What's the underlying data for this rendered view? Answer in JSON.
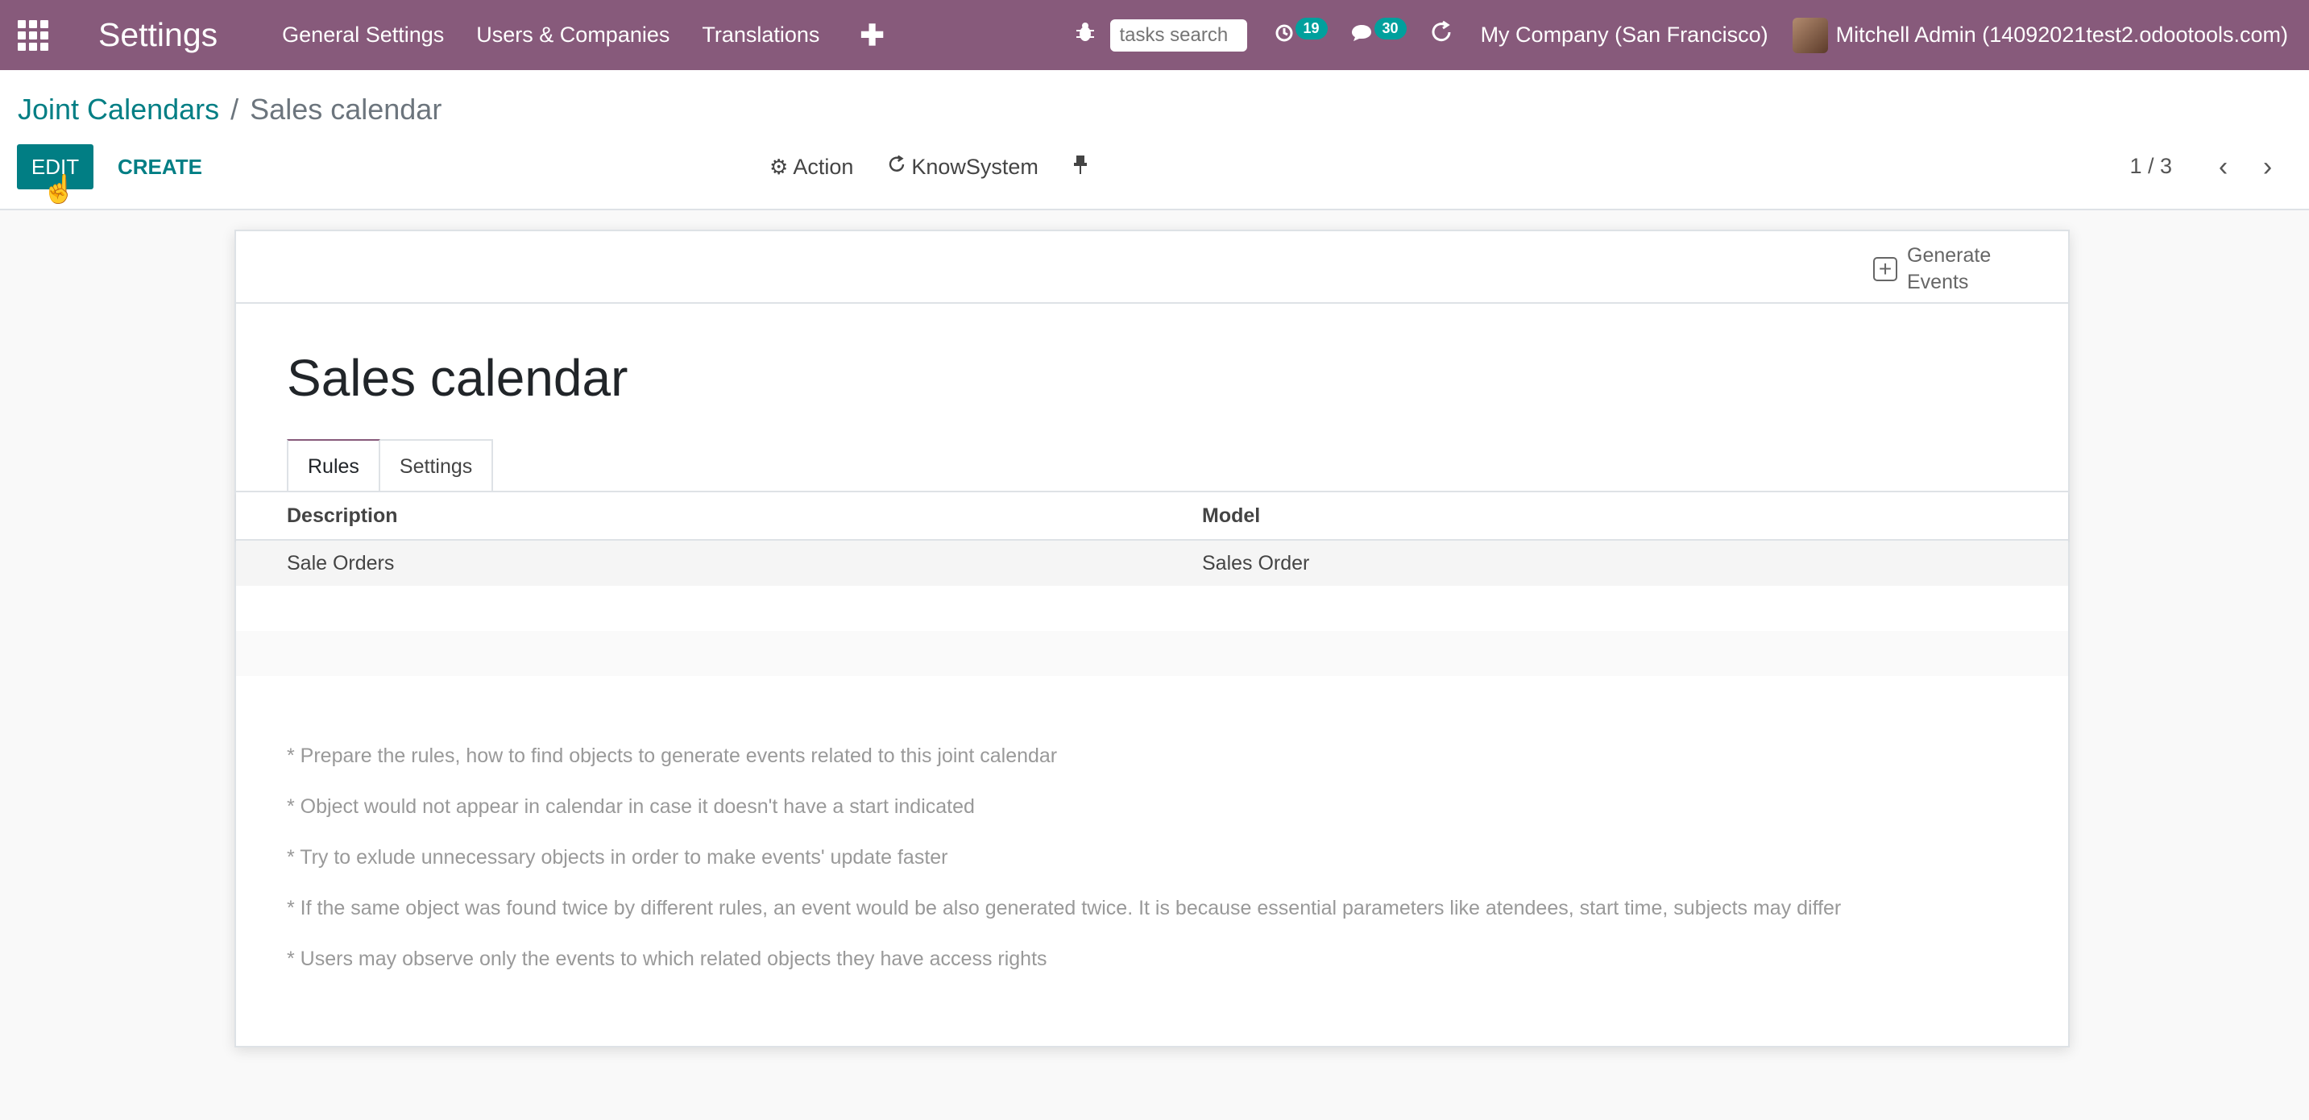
{
  "navbar": {
    "app_name": "Settings",
    "menu": [
      "General Settings",
      "Users & Companies",
      "Translations"
    ],
    "search_placeholder": "tasks search",
    "activity_count": "19",
    "messages_count": "30",
    "company": "My Company (San Francisco)",
    "user": "Mitchell Admin (14092021test2.odootools.com)"
  },
  "control_panel": {
    "breadcrumb_parent": "Joint Calendars",
    "breadcrumb_separator": "/",
    "breadcrumb_current": "Sales calendar",
    "edit_label": "EDIT",
    "create_label": "CREATE",
    "action_label": "Action",
    "knowsystem_label": "KnowSystem",
    "pager": "1 / 3"
  },
  "form": {
    "generate_events_label": "Generate Events",
    "title": "Sales calendar",
    "tabs": [
      "Rules",
      "Settings"
    ],
    "table": {
      "headers": [
        "Description",
        "Model"
      ],
      "rows": [
        {
          "description": "Sale Orders",
          "model": "Sales Order"
        }
      ]
    },
    "notes": [
      "* Prepare the rules, how to find objects to generate events related to this joint calendar",
      "* Object would not appear in calendar in case it doesn't have a start indicated",
      "* Try to exlude unnecessary objects in order to make events' update faster",
      "* If the same object was found twice by different rules, an event would be also generated twice. It is because essential parameters like atendees, start time, subjects may differ",
      "* Users may observe only the events to which related objects they have access rights"
    ]
  },
  "colors": {
    "navbar": "#875a7b",
    "primary": "#017e84",
    "badge": "#00a09d"
  }
}
